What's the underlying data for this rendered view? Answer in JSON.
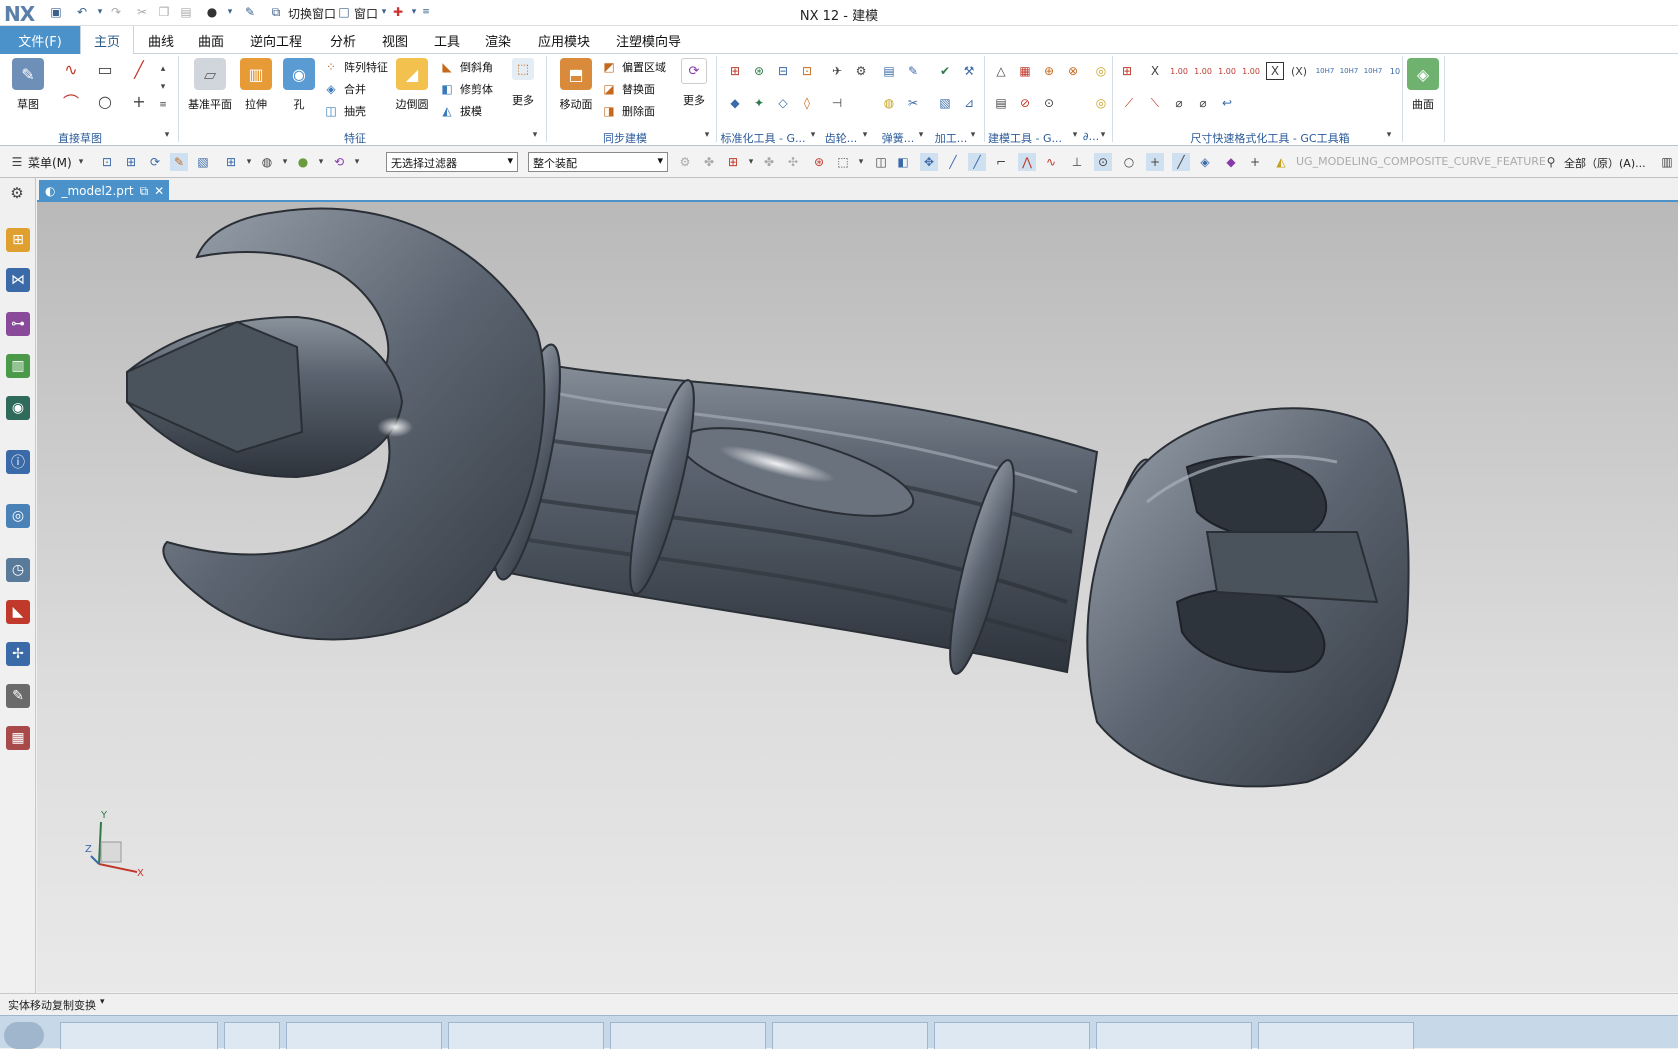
{
  "app": {
    "logo": "NX",
    "title": "NX 12 - 建模",
    "quick_toolbar": {
      "switch_window": "切换窗口",
      "window": "窗口"
    }
  },
  "menu": {
    "file": "文件(F)",
    "tabs": [
      "主页",
      "曲线",
      "曲面",
      "逆向工程",
      "分析",
      "视图",
      "工具",
      "渲染",
      "应用模块",
      "注塑模向导"
    ]
  },
  "ribbon": {
    "sketch": {
      "label": "草图",
      "group": "直接草图"
    },
    "feature": {
      "datum_plane": "基准平面",
      "extrude": "拉伸",
      "hole": "孔",
      "pattern": "阵列特征",
      "unite": "合并",
      "shell": "抽壳",
      "edge_blend": "边倒圆",
      "chamfer": "倒斜角",
      "trim_body": "修剪体",
      "draft": "拔模",
      "more": "更多",
      "group": "特征"
    },
    "sync": {
      "move_face": "移动面",
      "offset_region": "偏置区域",
      "replace_face": "替换面",
      "delete_face": "删除面",
      "more": "更多",
      "group": "同步建模"
    },
    "std_groups": [
      "标准化工具 - G...",
      "齿轮...",
      "弹簧...",
      "加工...",
      "建模工具 - G...",
      "∂..."
    ],
    "dim_group": "尺寸快速格式化工具 - GC工具箱",
    "dim_labels": [
      "X",
      "1.00",
      "1.00",
      "1.00",
      "1.00",
      "(X)",
      "10H7",
      "10H7",
      "10H7",
      "10"
    ],
    "surface": {
      "label": "曲面"
    }
  },
  "toolbar2": {
    "menu": "菜单(M)",
    "filter": "无选择过滤器",
    "assembly": "整个装配",
    "feature_hint": "UG_MODELING_COMPOSITE_CURVE_FEATURE",
    "scope": "全部（原）(A)..."
  },
  "document": {
    "tab": "_model2.prt"
  },
  "triad": {
    "x": "X",
    "y": "Y",
    "z": "Z"
  },
  "status": {
    "message": "实体移动复制变换"
  },
  "colors": {
    "accent": "#4a92c9",
    "model": "#5b6470"
  }
}
